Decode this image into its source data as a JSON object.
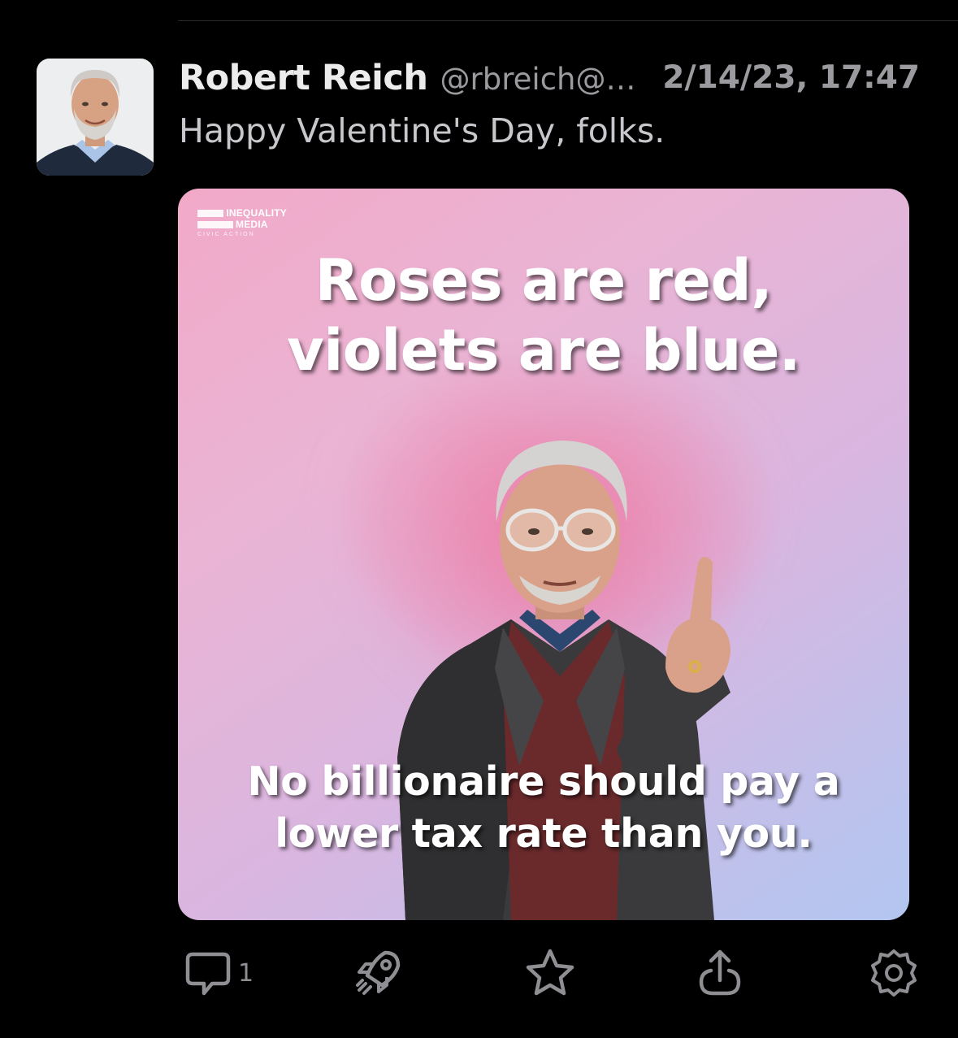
{
  "post": {
    "author_name": "Robert Reich",
    "author_handle": "@rbreich@…",
    "timestamp": "2/14/23, 17:47",
    "text": "Happy Valentine's Day, folks."
  },
  "media": {
    "brand_line1": "INEQUALITY",
    "brand_line2": "MEDIA",
    "brand_line3": "CIVIC ACTION",
    "headline_line1": "Roses are red,",
    "headline_line2": "violets are blue.",
    "caption_line1": "No billionaire should pay a",
    "caption_line2": "lower tax rate than you."
  },
  "actions": {
    "reply_count": "1",
    "icons": [
      "reply-icon",
      "boost-icon",
      "favorite-icon",
      "share-icon",
      "more-icon"
    ]
  },
  "colors": {
    "background": "#000000",
    "name": "#ececec",
    "secondary": "#9b9b9f",
    "icon": "#8e8e93"
  }
}
